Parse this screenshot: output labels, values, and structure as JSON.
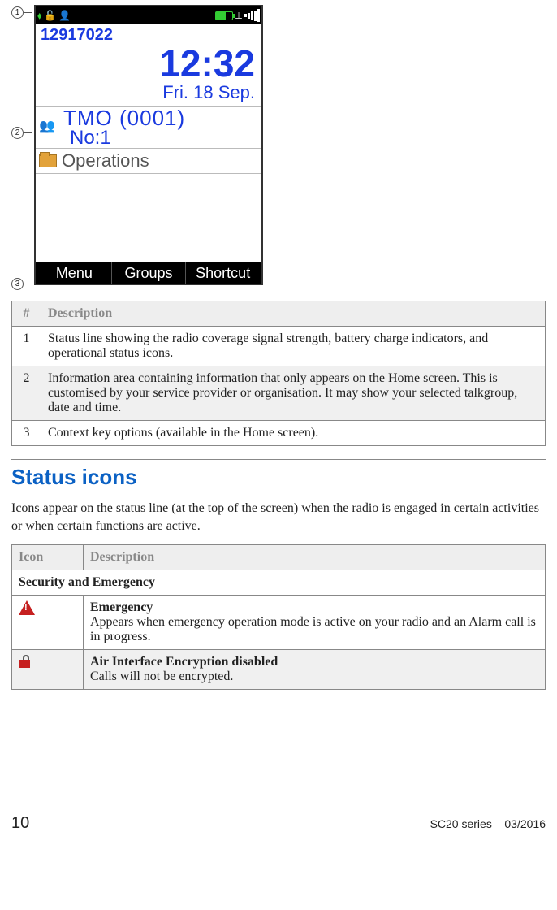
{
  "callouts": {
    "c1": "1",
    "c2": "2",
    "c3": "3"
  },
  "phone": {
    "id": "12917022",
    "time": "12:32",
    "date": "Fri. 18 Sep.",
    "talkgroup": "TMO (0001)",
    "no_line": "No:1",
    "operations": "Operations",
    "softkey_left": "Menu",
    "softkey_center": "Groups",
    "softkey_right": "Shortcut"
  },
  "table1": {
    "head_num": "#",
    "head_desc": "Description",
    "r1_num": "1",
    "r1_desc": "Status line showing the radio coverage signal strength, battery charge indicators, and operational status icons.",
    "r2_num": "2",
    "r2_desc": "Information area containing information that only appears on the Home screen. This is customised by your service provider or organisation. It may show your selected talkgroup, date and time.",
    "r3_num": "3",
    "r3_desc": "Context key options (available in the Home screen)."
  },
  "section_title": "Status icons",
  "intro_para": "Icons appear on the status line (at the top of the screen) when the radio is engaged in certain activities or when certain functions are active.",
  "table2": {
    "head_icon": "Icon",
    "head_desc": "Description",
    "subhead": "Security and Emergency",
    "r1_title": "Emergency",
    "r1_desc": "Appears when emergency operation mode is active on your radio and an Alarm call is in progress.",
    "r2_title": "Air Interface Encryption disabled",
    "r2_desc": "Calls will not be encrypted."
  },
  "footer": {
    "page": "10",
    "doc_id": "SC20 series – 03/2016"
  }
}
